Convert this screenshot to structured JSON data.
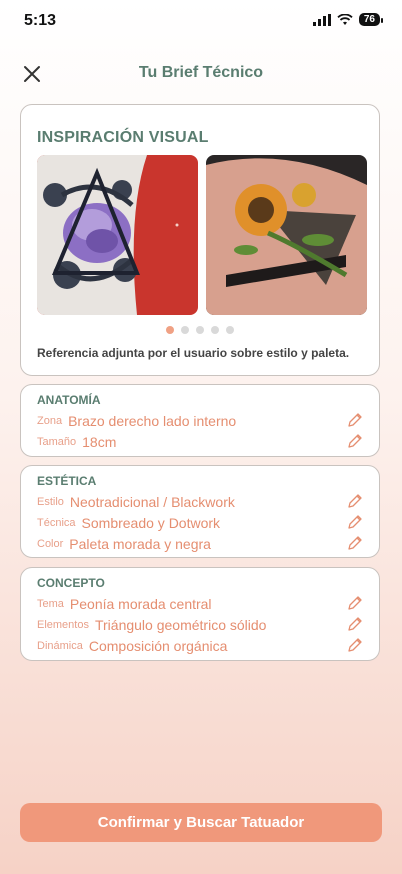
{
  "status": {
    "time": "5:13",
    "battery": "76"
  },
  "header": {
    "title": "Tu Brief Técnico"
  },
  "inspiration": {
    "title": "INSPIRACIÓN VISUAL",
    "caption": "Referencia adjunta por el usuario sobre estilo y paleta."
  },
  "anatomy": {
    "title": "ANATOMÍA",
    "rows": [
      {
        "label": "Zona",
        "value": "Brazo derecho lado interno"
      },
      {
        "label": "Tamaño",
        "value": "18cm"
      }
    ]
  },
  "aesthetics": {
    "title": "ESTÉTICA",
    "rows": [
      {
        "label": "Estilo",
        "value": "Neotradicional / Blackwork"
      },
      {
        "label": "Técnica",
        "value": "Sombreado y Dotwork"
      },
      {
        "label": "Color",
        "value": "Paleta morada y negra"
      }
    ]
  },
  "concept": {
    "title": "CONCEPTO",
    "rows": [
      {
        "label": "Tema",
        "value": "Peonía morada central"
      },
      {
        "label": "Elementos",
        "value": "Triángulo geométrico sólido"
      },
      {
        "label": "Dinámica",
        "value": "Composición orgánica"
      }
    ]
  },
  "carousel": {
    "count": 5,
    "active_index": 0
  },
  "cta": {
    "label": "Confirmar y Buscar Tatuador"
  },
  "colors": {
    "accent": "#f0987b",
    "heading": "#5a7d70",
    "value_text": "#e58e70"
  }
}
